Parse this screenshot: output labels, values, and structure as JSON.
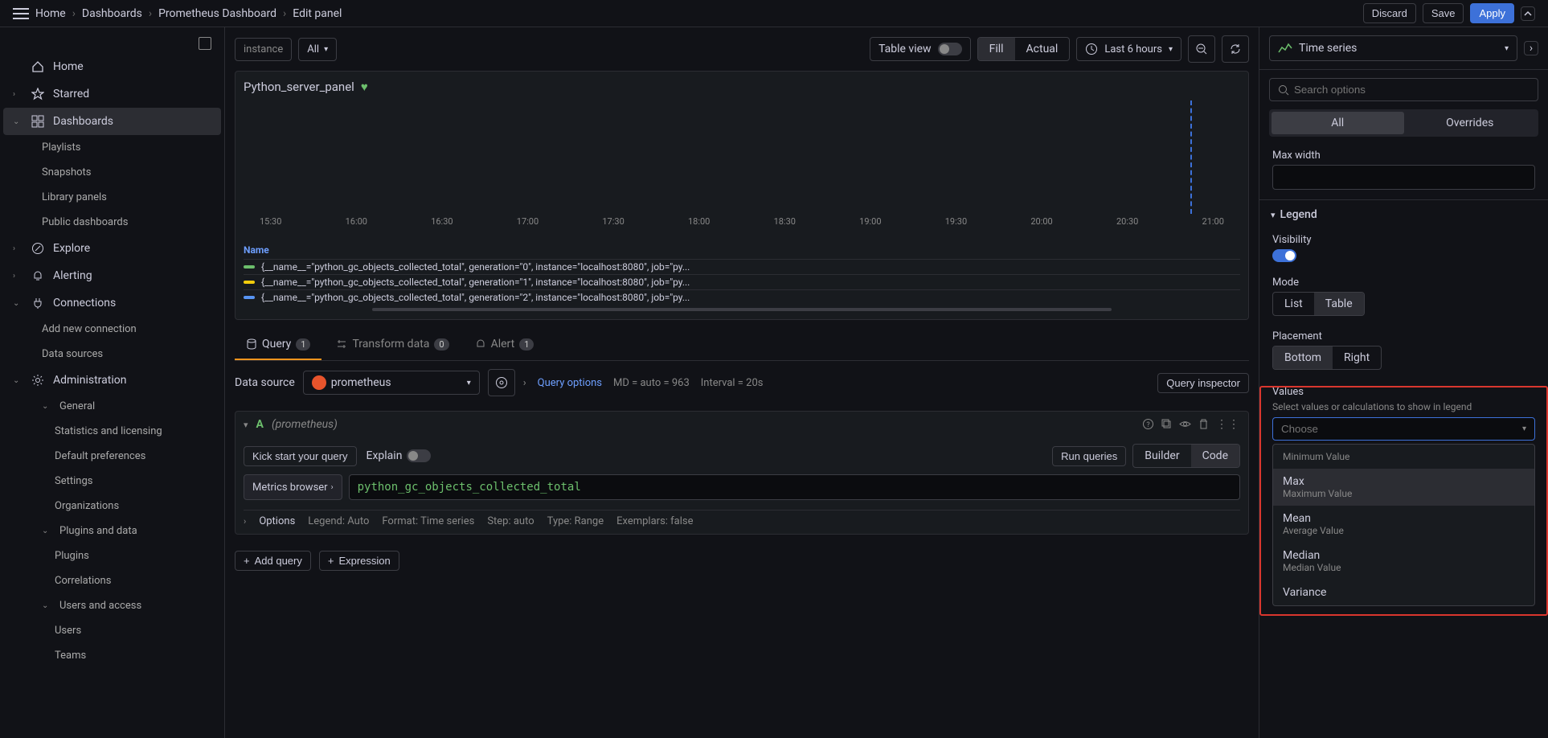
{
  "breadcrumb": {
    "home": "Home",
    "dashboards": "Dashboards",
    "dashboard": "Prometheus Dashboard",
    "edit": "Edit panel"
  },
  "top_actions": {
    "discard": "Discard",
    "save": "Save",
    "apply": "Apply"
  },
  "sidebar": {
    "items": [
      {
        "label": "Home",
        "icon": "home"
      },
      {
        "label": "Starred",
        "icon": "star"
      },
      {
        "label": "Dashboards",
        "icon": "apps",
        "active": true
      },
      {
        "label": "Playlists",
        "child": true
      },
      {
        "label": "Snapshots",
        "child": true
      },
      {
        "label": "Library panels",
        "child": true
      },
      {
        "label": "Public dashboards",
        "child": true
      },
      {
        "label": "Explore",
        "icon": "compass"
      },
      {
        "label": "Alerting",
        "icon": "bell"
      },
      {
        "label": "Connections",
        "icon": "plug"
      },
      {
        "label": "Add new connection",
        "child": true
      },
      {
        "label": "Data sources",
        "child": true
      },
      {
        "label": "Administration",
        "icon": "gear"
      },
      {
        "label": "General",
        "child": true,
        "expandable": true
      },
      {
        "label": "Statistics and licensing",
        "subchild": true
      },
      {
        "label": "Default preferences",
        "subchild": true
      },
      {
        "label": "Settings",
        "subchild": true
      },
      {
        "label": "Organizations",
        "subchild": true
      },
      {
        "label": "Plugins and data",
        "child": true,
        "expandable": true
      },
      {
        "label": "Plugins",
        "subchild": true
      },
      {
        "label": "Correlations",
        "subchild": true
      },
      {
        "label": "Users and access",
        "child": true,
        "expandable": true
      },
      {
        "label": "Users",
        "subchild": true
      },
      {
        "label": "Teams",
        "subchild": true
      }
    ]
  },
  "toolbar": {
    "instance_var": "instance",
    "instance_value": "All",
    "table_view": "Table view",
    "fill": "Fill",
    "actual": "Actual",
    "time_range": "Last 6 hours"
  },
  "panel": {
    "title": "Python_server_panel",
    "name_hdr": "Name"
  },
  "chart_data": {
    "type": "line",
    "xlabel": "",
    "ylabel": "",
    "x_ticks": [
      "15:30",
      "16:00",
      "16:30",
      "17:00",
      "17:30",
      "18:00",
      "18:30",
      "19:00",
      "19:30",
      "20:00",
      "20:30",
      "21:00"
    ],
    "marker_x": "21:00",
    "series": [
      {
        "name": "{__name__=\"python_gc_objects_collected_total\", generation=\"0\", instance=\"localhost:8080\", job=\"py...",
        "color": "#6cbf6c"
      },
      {
        "name": "{__name__=\"python_gc_objects_collected_total\", generation=\"1\", instance=\"localhost:8080\", job=\"py...",
        "color": "#f2cc0c"
      },
      {
        "name": "{__name__=\"python_gc_objects_collected_total\", generation=\"2\", instance=\"localhost:8080\", job=\"py...",
        "color": "#5794f2"
      }
    ]
  },
  "tabs": {
    "query": "Query",
    "query_count": "1",
    "transform": "Transform data",
    "transform_count": "0",
    "alert": "Alert",
    "alert_count": "1"
  },
  "query_bar": {
    "data_source_lbl": "Data source",
    "data_source": "prometheus",
    "options_link": "Query options",
    "md": "MD = auto = 963",
    "interval": "Interval = 20s",
    "inspect": "Query inspector"
  },
  "query": {
    "letter": "A",
    "meta": "(prometheus)",
    "kick": "Kick start your query",
    "explain": "Explain",
    "run": "Run queries",
    "builder": "Builder",
    "code": "Code",
    "metrics_browser": "Metrics browser",
    "expression": "python_gc_objects_collected_total",
    "options_lbl": "Options",
    "legend": "Legend: Auto",
    "format": "Format: Time series",
    "step": "Step: auto",
    "type": "Type: Range",
    "exemplars": "Exemplars: false"
  },
  "footer": {
    "add_query": "Add query",
    "expression": "Expression"
  },
  "right": {
    "viz_type": "Time series",
    "search_placeholder": "Search options",
    "mode_all": "All",
    "mode_over": "Overrides",
    "max_width_lbl": "Max width",
    "legend_hdr": "Legend",
    "visibility_lbl": "Visibility",
    "mode_lbl": "Mode",
    "mode_list": "List",
    "mode_table": "Table",
    "placement_lbl": "Placement",
    "placement_bottom": "Bottom",
    "placement_right": "Right",
    "values_lbl": "Values",
    "values_sub": "Select values or calculations to show in legend",
    "combo_placeholder": "Choose",
    "dd": [
      {
        "title": "",
        "sub": "Minimum Value"
      },
      {
        "title": "Max",
        "sub": "Maximum Value"
      },
      {
        "title": "Mean",
        "sub": "Average Value"
      },
      {
        "title": "Median",
        "sub": "Median Value"
      },
      {
        "title": "Variance",
        "sub": ""
      }
    ]
  }
}
